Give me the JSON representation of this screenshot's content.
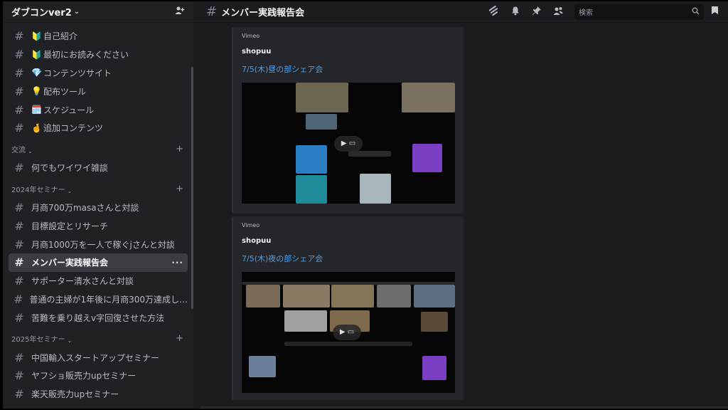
{
  "server": {
    "name": "ダブコンver2"
  },
  "channels_top": [
    {
      "emoji": "🔰",
      "label": "自己紹介"
    },
    {
      "emoji": "🔰",
      "label": "最初にお読みください"
    },
    {
      "emoji": "💎",
      "label": "コンテンツサイト"
    },
    {
      "emoji": "💡",
      "label": "配布ツール"
    },
    {
      "emoji": "🗓️",
      "label": "スケジュール"
    },
    {
      "emoji": "🤞",
      "label": "追加コンテンツ"
    }
  ],
  "categories": [
    {
      "name": "交流",
      "channels": [
        "何でもワイワイ雑談"
      ]
    },
    {
      "name": "2024年セミナー",
      "channels": [
        "月商700万masaさんと対談",
        "目標設定とリサーチ",
        "月商1000万を一人で稼ぐjさんと対談",
        "メンバー実践報告会",
        "サポーター清水さんと対談",
        "普通の主婦が1年後に月商300万達成し…",
        "苦難を乗り越えv字回復させた方法"
      ]
    },
    {
      "name": "2025年セミナー",
      "channels": [
        "中国輸入スタートアップセミナー",
        "ヤフショ販売力upセミナー",
        "楽天販売力upセミナー"
      ]
    }
  ],
  "more_label": "···",
  "header": {
    "channel_title": "メンバー実践報告会",
    "search_placeholder": "検索"
  },
  "embeds": [
    {
      "provider": "Vimeo",
      "author": "shopuu",
      "title": "7/5(木)昼の部シェア会"
    },
    {
      "provider": "Vimeo",
      "author": "shopuu",
      "title": "7/5(木)夜の部シェア会"
    }
  ],
  "colors": {
    "link": "#4a9ee8",
    "sidebar_bg": "#202125",
    "main_bg": "#1b1c20",
    "embed_bg": "#25262b"
  }
}
